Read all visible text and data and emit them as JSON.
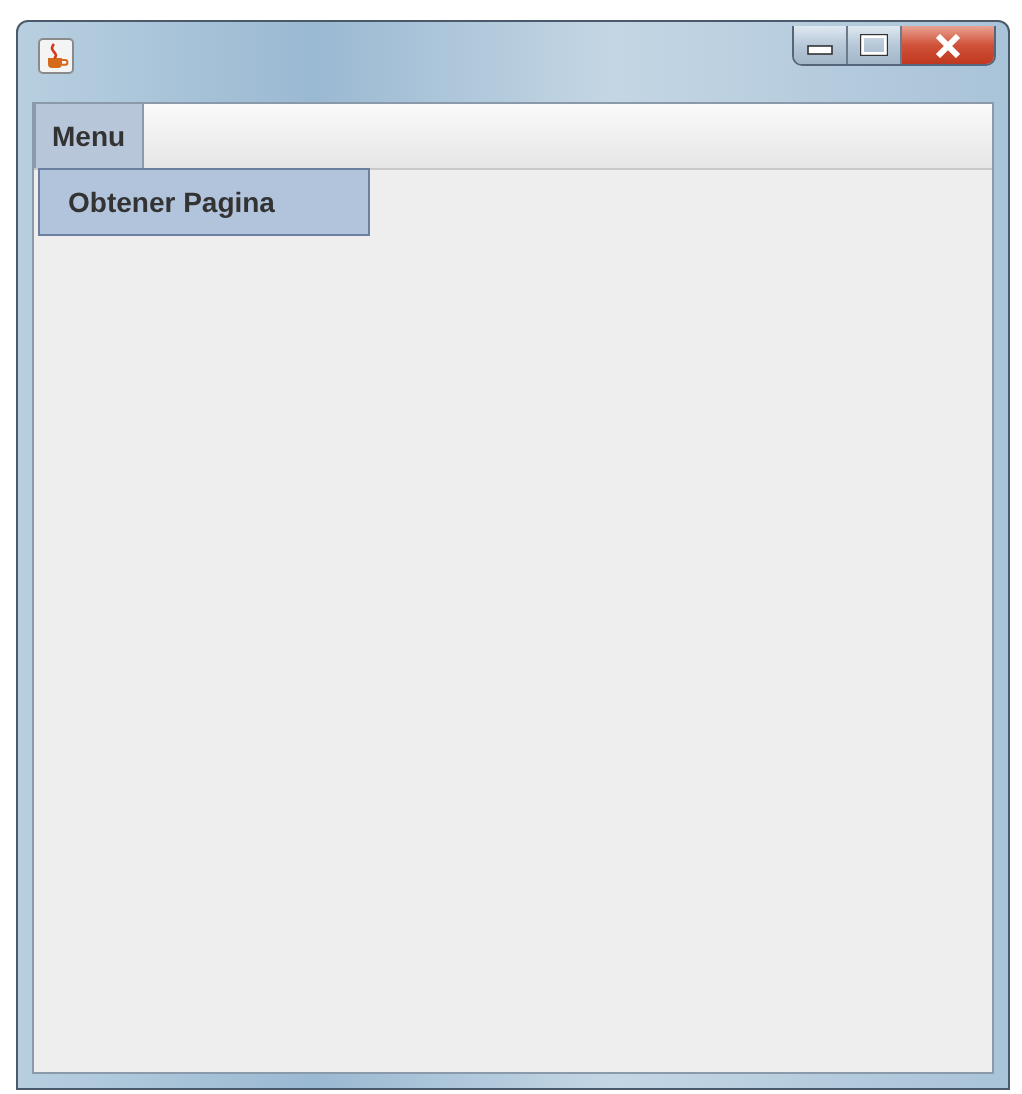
{
  "menu_bar": [
    {
      "label": "Menu",
      "selected": true
    }
  ],
  "dropdown": [
    {
      "label": "Obtener Pagina",
      "selected": true
    }
  ]
}
